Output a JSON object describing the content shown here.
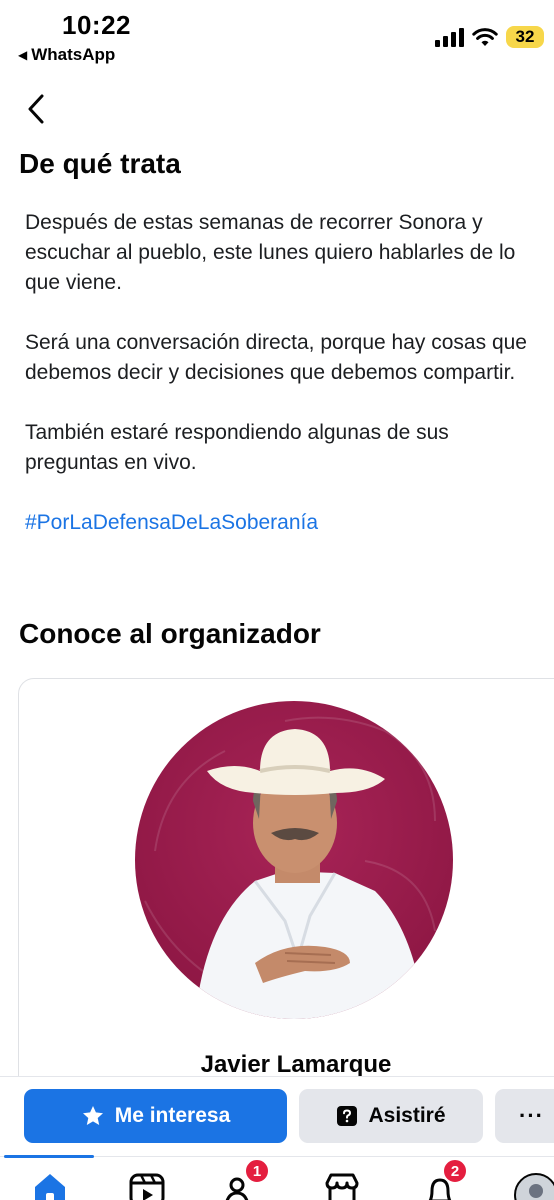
{
  "status_bar": {
    "time": "10:22",
    "back_app": "WhatsApp",
    "battery": "32",
    "back_triangle": "◀"
  },
  "header": {
    "back_icon": "chevron-left-icon"
  },
  "about": {
    "title": "De qué trata",
    "paragraphs": [
      "Después de estas semanas de recorrer Sonora y escuchar al pueblo, este lunes quiero hablarles de lo que viene.",
      "Será una conversación directa, porque hay cosas que debemos decir y decisiones que debemos compartir.",
      "También estaré respondiendo algunas de sus preguntas en vivo."
    ],
    "hashtag": "#PorLaDefensaDeLaSoberanía"
  },
  "organizer": {
    "title": "Conoce al organizador",
    "name": "Javier Lamarque"
  },
  "actions": {
    "interested_label": "Me interesa",
    "going_label": "Asistiré",
    "more_label": "···"
  },
  "tab_bar": {
    "items": [
      {
        "icon": "home-icon",
        "active": true
      },
      {
        "icon": "video-icon"
      },
      {
        "icon": "friends-icon",
        "badge": "1"
      },
      {
        "icon": "marketplace-icon"
      },
      {
        "icon": "notifications-icon",
        "badge": "2"
      },
      {
        "icon": "profile-avatar"
      }
    ]
  },
  "colors": {
    "accent": "#1b74e4",
    "badge": "#e41e3f",
    "avatar_bg": "#9b1b4a"
  }
}
